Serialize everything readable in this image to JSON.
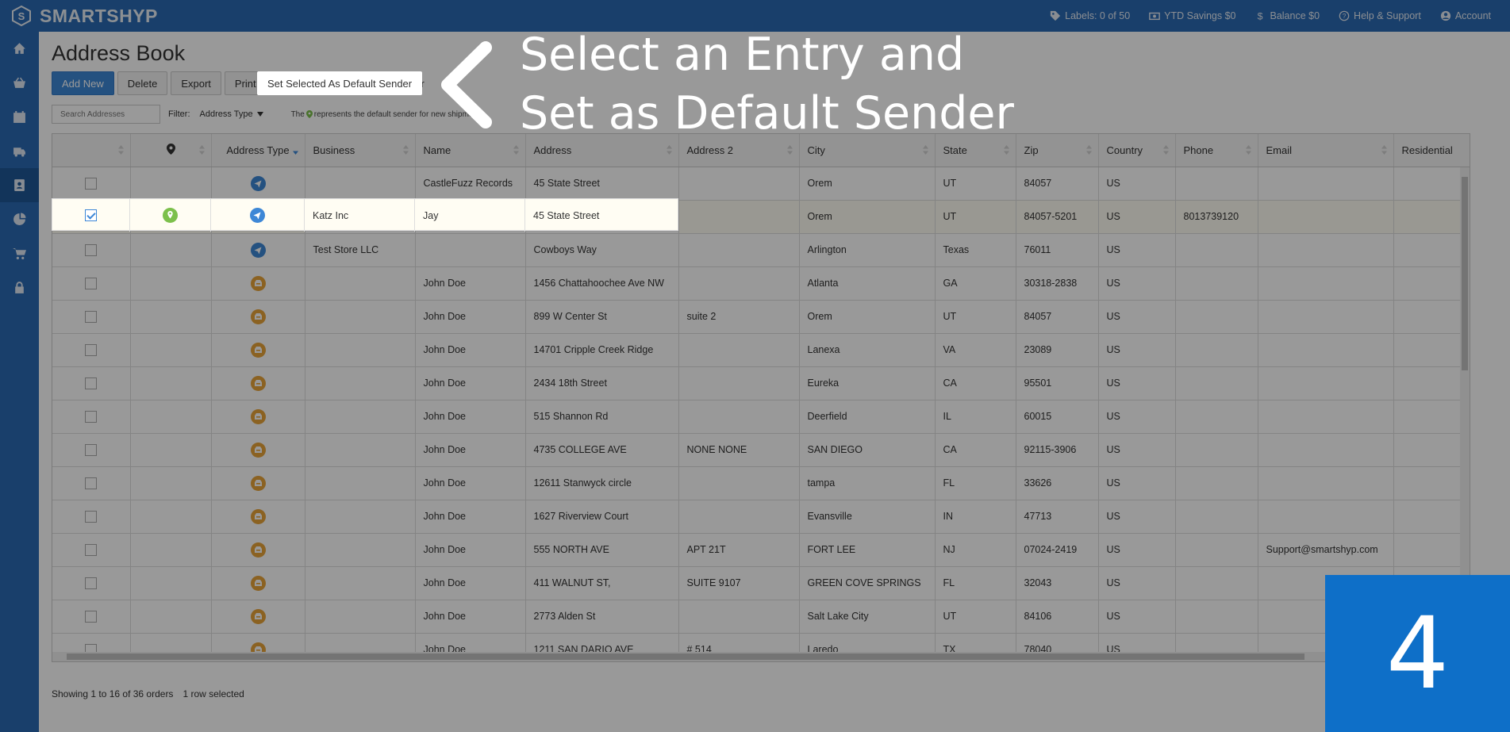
{
  "app": {
    "brand": "SMARTSHYP"
  },
  "topbar": {
    "items": [
      {
        "icon": "tag-icon",
        "label": "Labels: 0 of 50"
      },
      {
        "icon": "money-icon",
        "label": "YTD Savings $0"
      },
      {
        "icon": "dollar-icon",
        "label": "Balance $0"
      },
      {
        "icon": "help-icon",
        "label": "Help & Support"
      },
      {
        "icon": "account-icon",
        "label": "Account"
      }
    ]
  },
  "sidebar": {
    "items": [
      {
        "icon": "home-icon"
      },
      {
        "icon": "basket-icon"
      },
      {
        "icon": "calendar-icon"
      },
      {
        "icon": "truck-icon"
      },
      {
        "icon": "address-book-icon",
        "active": true
      },
      {
        "icon": "pie-chart-icon"
      },
      {
        "icon": "cart-icon"
      },
      {
        "icon": "lock-icon"
      }
    ]
  },
  "page": {
    "title": "Address Book"
  },
  "toolbar": {
    "add_new": "Add New",
    "delete": "Delete",
    "export": "Export",
    "print": "Print",
    "set_default": "Set Selected As Default Sender"
  },
  "filters": {
    "search_placeholder": "Search Addresses",
    "filter_label": "Filter:",
    "address_type": "Address Type",
    "note_before": "The",
    "note_after": "represents the default sender for new shipments."
  },
  "table": {
    "columns": [
      "",
      "",
      "Address Type",
      "Business",
      "Name",
      "Address",
      "Address 2",
      "City",
      "State",
      "Zip",
      "Country",
      "Phone",
      "Email",
      "Residential"
    ],
    "rows": [
      {
        "checked": false,
        "default": false,
        "type": "sender",
        "business": "",
        "name": "CastleFuzz Records",
        "address": "45 State Street",
        "address2": "",
        "city": "Orem",
        "state": "UT",
        "zip": "84057",
        "country": "US",
        "phone": "",
        "email": ""
      },
      {
        "checked": true,
        "default": true,
        "type": "sender",
        "business": "Katz Inc",
        "name": "Jay",
        "address": "45 State Street",
        "address2": "",
        "city": "Orem",
        "state": "UT",
        "zip": "84057-5201",
        "country": "US",
        "phone": "8013739120",
        "email": ""
      },
      {
        "checked": false,
        "default": false,
        "type": "sender",
        "business": "Test Store LLC",
        "name": "",
        "address": "Cowboys Way",
        "address2": "",
        "city": "Arlington",
        "state": "Texas",
        "zip": "76011",
        "country": "US",
        "phone": "",
        "email": ""
      },
      {
        "checked": false,
        "default": false,
        "type": "recipient",
        "business": "",
        "name": "John Doe",
        "address": "1456 Chattahoochee Ave NW",
        "address2": "",
        "city": "Atlanta",
        "state": "GA",
        "zip": "30318-2838",
        "country": "US",
        "phone": "",
        "email": ""
      },
      {
        "checked": false,
        "default": false,
        "type": "recipient",
        "business": "",
        "name": "John Doe",
        "address": "899 W Center St",
        "address2": "suite 2",
        "city": "Orem",
        "state": "UT",
        "zip": "84057",
        "country": "US",
        "phone": "",
        "email": ""
      },
      {
        "checked": false,
        "default": false,
        "type": "recipient",
        "business": "",
        "name": "John Doe",
        "address": "14701 Cripple Creek Ridge",
        "address2": "",
        "city": "Lanexa",
        "state": "VA",
        "zip": "23089",
        "country": "US",
        "phone": "",
        "email": ""
      },
      {
        "checked": false,
        "default": false,
        "type": "recipient",
        "business": "",
        "name": "John Doe",
        "address": "2434 18th Street",
        "address2": "",
        "city": "Eureka",
        "state": "CA",
        "zip": "95501",
        "country": "US",
        "phone": "",
        "email": ""
      },
      {
        "checked": false,
        "default": false,
        "type": "recipient",
        "business": "",
        "name": "John Doe",
        "address": "515 Shannon Rd",
        "address2": "",
        "city": "Deerfield",
        "state": "IL",
        "zip": "60015",
        "country": "US",
        "phone": "",
        "email": ""
      },
      {
        "checked": false,
        "default": false,
        "type": "recipient",
        "business": "",
        "name": "John Doe",
        "address": "4735 COLLEGE AVE",
        "address2": "NONE NONE",
        "city": "SAN DIEGO",
        "state": "CA",
        "zip": "92115-3906",
        "country": "US",
        "phone": "",
        "email": ""
      },
      {
        "checked": false,
        "default": false,
        "type": "recipient",
        "business": "",
        "name": "John Doe",
        "address": "12611 Stanwyck circle",
        "address2": "",
        "city": "tampa",
        "state": "FL",
        "zip": "33626",
        "country": "US",
        "phone": "",
        "email": ""
      },
      {
        "checked": false,
        "default": false,
        "type": "recipient",
        "business": "",
        "name": "John Doe",
        "address": "1627 Riverview Court",
        "address2": "",
        "city": "Evansville",
        "state": "IN",
        "zip": "47713",
        "country": "US",
        "phone": "",
        "email": ""
      },
      {
        "checked": false,
        "default": false,
        "type": "recipient",
        "business": "",
        "name": "John Doe",
        "address": "555 NORTH AVE",
        "address2": "APT 21T",
        "city": "FORT LEE",
        "state": "NJ",
        "zip": "07024-2419",
        "country": "US",
        "phone": "",
        "email": "Support@smartshyp.com"
      },
      {
        "checked": false,
        "default": false,
        "type": "recipient",
        "business": "",
        "name": "John Doe",
        "address": "411 WALNUT ST,",
        "address2": "SUITE 9107",
        "city": "GREEN COVE SPRINGS",
        "state": "FL",
        "zip": "32043",
        "country": "US",
        "phone": "",
        "email": ""
      },
      {
        "checked": false,
        "default": false,
        "type": "recipient",
        "business": "",
        "name": "John Doe",
        "address": "2773 Alden St",
        "address2": "",
        "city": "Salt Lake City",
        "state": "UT",
        "zip": "84106",
        "country": "US",
        "phone": "",
        "email": ""
      },
      {
        "checked": false,
        "default": false,
        "type": "recipient",
        "business": "",
        "name": "John Doe",
        "address": "1211 SAN DARIO AVE",
        "address2": "# 514",
        "city": "Laredo",
        "state": "TX",
        "zip": "78040",
        "country": "US",
        "phone": "",
        "email": ""
      }
    ]
  },
  "status": {
    "showing": "Showing 1 to 16 of 36 orders",
    "selected": "1 row selected"
  },
  "callout": {
    "line1": "Select an Entry and",
    "line2": "Set as Default Sender"
  },
  "step": {
    "number": "4"
  },
  "colors": {
    "brand_blue": "#2a6ab3",
    "sender_icon": "#3d87d6",
    "recipient_icon": "#e8a33a",
    "default_pin": "#7cc04b",
    "step_badge": "#0e6fc8"
  }
}
